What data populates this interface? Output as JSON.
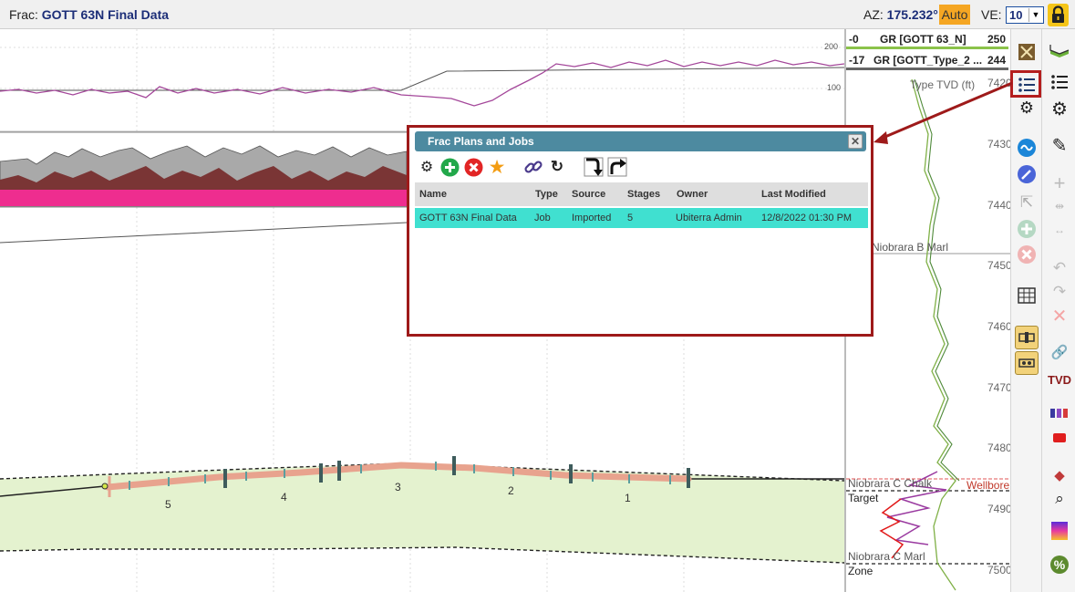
{
  "header": {
    "frac_prefix": "Frac:",
    "frac_name": "GOTT 63N Final Data",
    "az_label": "AZ:",
    "az_value": "175.232°",
    "auto_label": "Auto",
    "ve_label": "VE:",
    "ve_value": "10"
  },
  "logs": {
    "gr1": {
      "min": "-0",
      "name": "GR [GOTT 63_N]",
      "max": "250"
    },
    "gr2": {
      "min": "-17",
      "name": "GR [GOTT_Type_2 ...",
      "max": "244"
    },
    "scale_200": "200",
    "scale_100": "100",
    "type_tvd_label": "Type TVD (ft)",
    "tvd_ticks": [
      "7420",
      "7430",
      "7440",
      "7450",
      "7460",
      "7470",
      "7480",
      "7490",
      "7500"
    ],
    "formations": {
      "marl_b": "Niobrara B Marl",
      "chalk": "Niobrara C Chalk",
      "wellbore": "Wellbore",
      "target": "Target",
      "marl_c": "Niobrara C Marl",
      "zone": "Zone"
    }
  },
  "stages": [
    "5",
    "4",
    "3",
    "2",
    "1"
  ],
  "dialog": {
    "title": "Frac Plans and Jobs",
    "columns": [
      "Name",
      "Type",
      "Source",
      "Stages",
      "Owner",
      "Last Modified"
    ],
    "rows": [
      {
        "name": "GOTT 63N Final Data",
        "type": "Job",
        "source": "Imported",
        "stages": "5",
        "owner": "Ubiterra Admin",
        "modified": "12/8/2022 01:30 PM"
      }
    ]
  },
  "toolbar": {
    "tvd_label": "TVD"
  },
  "colors": {
    "header_text": "#1c2e78",
    "auto_bg": "#f5a623",
    "lock_bg": "#f5c518",
    "dialog_border": "#9e1a1a",
    "dialog_header": "#4d8aa0",
    "selected_row": "#40e0d0",
    "zone_fill": "#e4f2cf",
    "frac_path": "#e8a38e"
  }
}
